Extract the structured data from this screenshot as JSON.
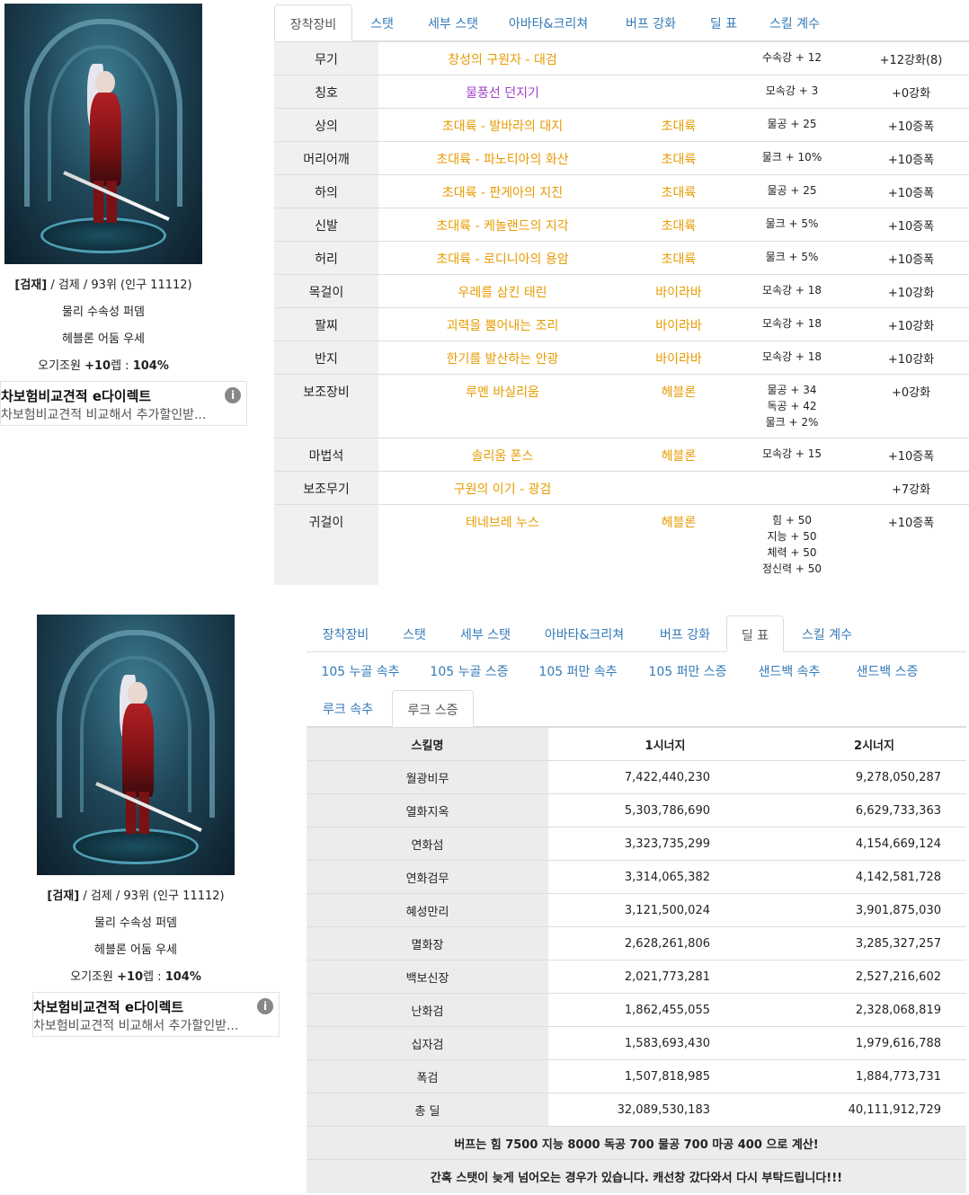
{
  "profile": {
    "rank_line_bracket": "[검재]",
    "rank_line_rest": " / 검제 / 93위 (인구 11112)",
    "line2": "물리 수속성 퍼뎀",
    "line3": "헤블론 어둠 우세",
    "line4_prefix": "오기조원 ",
    "line4_bold": "+10",
    "line4_mid": "렙 : ",
    "line4_value": "104%"
  },
  "ad": {
    "title": "차보험비교견적 e다이렉트",
    "desc": "차보험비교견적 비교해서 추가할인받...",
    "info_icon": "i"
  },
  "tabs_top": {
    "items": [
      "장착장비",
      "스탯",
      "세부 스탯",
      "아바타&크리쳐",
      "버프 강화",
      "딜 표",
      "스킬 계수"
    ],
    "active": 0
  },
  "tabs_bottom": {
    "items": [
      "장착장비",
      "스탯",
      "세부 스탯",
      "아바타&크리쳐",
      "버프 강화",
      "딜 표",
      "스킬 계수"
    ],
    "active": 5
  },
  "sub_tabs": {
    "items": [
      "105 누골 속추",
      "105 누골 스증",
      "105 퍼만 속추",
      "105 퍼만 스증",
      "샌드백 속추",
      "샌드백 스증",
      "루크 속추",
      "루크 스증"
    ],
    "active": 7
  },
  "equipment": [
    {
      "slot": "무기",
      "name": "창성의 구원자 - 대검",
      "set": "",
      "stats": [
        "수속강 + 12"
      ],
      "upgrade": "+12강화(8)",
      "name_color": "orange",
      "upg_color": "dark"
    },
    {
      "slot": "칭호",
      "name": "물풍선 던지기",
      "set": "",
      "stats": [
        "모속강 + 3"
      ],
      "upgrade": "+0강화",
      "name_color": "purple",
      "upg_color": "dark"
    },
    {
      "slot": "상의",
      "name": "초대륙 - 발바라의 대지",
      "set": "초대륙",
      "stats": [
        "물공 + 25"
      ],
      "upgrade": "+10증폭",
      "name_color": "orange",
      "upg_color": "magenta"
    },
    {
      "slot": "머리어깨",
      "name": "초대륙 - 파노티아의 화산",
      "set": "초대륙",
      "stats": [
        "물크 + 10%"
      ],
      "upgrade": "+10증폭",
      "name_color": "orange",
      "upg_color": "magenta"
    },
    {
      "slot": "하의",
      "name": "초대륙 - 판게아의 지진",
      "set": "초대륙",
      "stats": [
        "물공 + 25"
      ],
      "upgrade": "+10증폭",
      "name_color": "orange",
      "upg_color": "magenta"
    },
    {
      "slot": "신발",
      "name": "초대륙 - 케놀랜드의 지각",
      "set": "초대륙",
      "stats": [
        "물크 + 5%"
      ],
      "upgrade": "+10증폭",
      "name_color": "orange",
      "upg_color": "magenta"
    },
    {
      "slot": "허리",
      "name": "초대륙 - 로디니아의 용암",
      "set": "초대륙",
      "stats": [
        "물크 + 5%"
      ],
      "upgrade": "+10증폭",
      "name_color": "orange",
      "upg_color": "magenta"
    },
    {
      "slot": "목걸이",
      "name": "우레를 삼킨 태린",
      "set": "바이라바",
      "stats": [
        "모속강 + 18"
      ],
      "upgrade": "+10강화",
      "name_color": "orange",
      "upg_color": "dark"
    },
    {
      "slot": "팔찌",
      "name": "괴력을 뿜어내는 조리",
      "set": "바이라바",
      "stats": [
        "모속강 + 18"
      ],
      "upgrade": "+10강화",
      "name_color": "orange",
      "upg_color": "dark"
    },
    {
      "slot": "반지",
      "name": "한기를 발산하는 안광",
      "set": "바이라바",
      "stats": [
        "모속강 + 18"
      ],
      "upgrade": "+10강화",
      "name_color": "orange",
      "upg_color": "dark"
    },
    {
      "slot": "보조장비",
      "name": "루멘 바실리움",
      "set": "헤블론",
      "stats": [
        "물공 + 34",
        "독공 + 42",
        "물크 + 2%"
      ],
      "upgrade": "+0강화",
      "name_color": "orange",
      "upg_color": "dark"
    },
    {
      "slot": "마법석",
      "name": "솔리움 폰스",
      "set": "헤블론",
      "stats": [
        "모속강 + 15"
      ],
      "upgrade": "+10증폭",
      "name_color": "orange",
      "upg_color": "magenta"
    },
    {
      "slot": "보조무기",
      "name": "구원의 이기 - 광검",
      "set": "",
      "stats": [],
      "upgrade": "+7강화",
      "name_color": "orange",
      "upg_color": "dark"
    },
    {
      "slot": "귀걸이",
      "name": "테네브레 누스",
      "set": "헤블론",
      "stats": [
        "힘 + 50",
        "지능 + 50",
        "체력 + 50",
        "정신력 + 50"
      ],
      "upgrade": "+10증폭",
      "name_color": "orange",
      "upg_color": "magenta"
    }
  ],
  "damage_table": {
    "headers": [
      "스킬명",
      "1시너지",
      "2시너지"
    ],
    "rows": [
      [
        "월광비무",
        "7,422,440,230",
        "9,278,050,287"
      ],
      [
        "열화지옥",
        "5,303,786,690",
        "6,629,733,363"
      ],
      [
        "연화섬",
        "3,323,735,299",
        "4,154,669,124"
      ],
      [
        "연화검무",
        "3,314,065,382",
        "4,142,581,728"
      ],
      [
        "혜성만리",
        "3,121,500,024",
        "3,901,875,030"
      ],
      [
        "멸화장",
        "2,628,261,806",
        "3,285,327,257"
      ],
      [
        "백보신장",
        "2,021,773,281",
        "2,527,216,602"
      ],
      [
        "난화검",
        "1,862,455,055",
        "2,328,068,819"
      ],
      [
        "십자검",
        "1,583,693,430",
        "1,979,616,788"
      ],
      [
        "폭검",
        "1,507,818,985",
        "1,884,773,731"
      ],
      [
        "총 딜",
        "32,089,530,183",
        "40,111,912,729"
      ]
    ],
    "notes": [
      "버프는 힘 7500 지능 8000 독공 700 물공 700 마공 400 으로 계산!",
      "간혹 스탯이 늦게 넘어오는 경우가 있습니다. 캐선창 갔다와서 다시 부탁드립니다!!!"
    ]
  },
  "colors": {
    "orange": "#e79b00",
    "purple": "#a040c8",
    "magenta": "#c000c0",
    "link": "#337ab7",
    "row_header_bg": "#f0f0f0"
  }
}
